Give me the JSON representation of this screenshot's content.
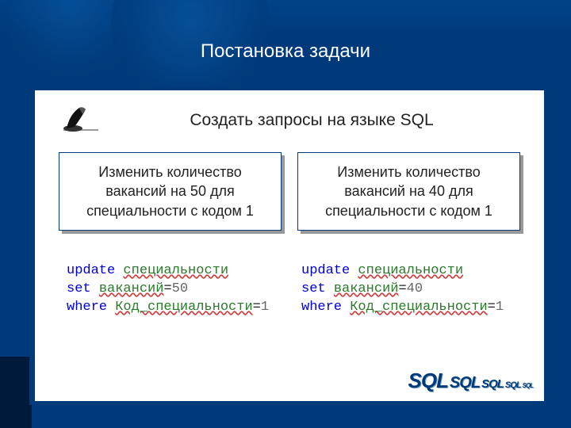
{
  "header": {
    "title": "Постановка задачи"
  },
  "subtitle": "Создать запросы на языке SQL",
  "tasks": [
    {
      "text": "Изменить количество вакансий на 50 для специальности с кодом 1"
    },
    {
      "text": "Изменить количество вакансий на 40 для специальности с кодом 1"
    }
  ],
  "code": [
    {
      "kw_update": "update",
      "table": "специальности",
      "kw_set": "set",
      "col_set": "вакансий",
      "val_set": "50",
      "kw_where": "where",
      "col_where": "Код_специальности",
      "val_where": "1"
    },
    {
      "kw_update": "update",
      "table": "специальности",
      "kw_set": "set",
      "col_set": "вакансий",
      "val_set": "40",
      "kw_where": "where",
      "col_where": "Код_специальности",
      "val_where": "1"
    }
  ],
  "logo": {
    "s1": "SQL",
    "s2": "SQL",
    "s3": "SQL",
    "s4": "SQL",
    "s5": "SQL"
  }
}
